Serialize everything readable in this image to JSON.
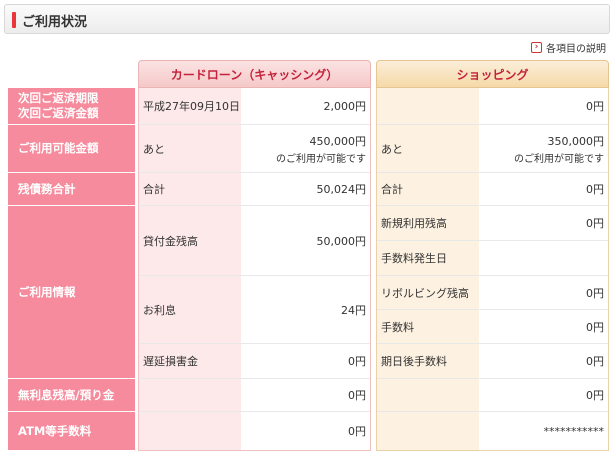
{
  "header": {
    "title": "ご利用状況"
  },
  "help": {
    "label": "各項目の説明"
  },
  "columns": {
    "card": "カードローン（キャッシング）",
    "shopping": "ショッピング"
  },
  "rows": {
    "next_payment": "次回ご返済期限\n次回ご返済金額",
    "available": "ご利用可能金額",
    "balance_total": "残債務合計",
    "usage_info": "ご利用情報",
    "interest_free": "無利息残高/預り金",
    "atm_fee": "ATM等手数料"
  },
  "card": {
    "next_date": "平成27年09月10日",
    "next_amount": "2,000円",
    "available_label": "あと",
    "available_amount": "450,000円",
    "available_note": "のご利用が可能です",
    "total_label": "合計",
    "total_amount": "50,024円",
    "loan_label": "貸付金残高",
    "loan_amount": "50,000円",
    "interest_label": "お利息",
    "interest_amount": "24円",
    "late_label": "遅延損害金",
    "late_amount": "0円",
    "interest_free_amount": "0円",
    "atm_amount": "0円"
  },
  "shopping": {
    "next_amount": "0円",
    "available_label": "あと",
    "available_amount": "350,000円",
    "available_note": "のご利用が可能です",
    "total_label": "合計",
    "total_amount": "0円",
    "new_label": "新規利用残高",
    "new_amount": "0円",
    "fee_date_label": "手数料発生日",
    "revo_label": "リボルビング残高",
    "revo_amount": "0円",
    "fee_label": "手数料",
    "fee_amount": "0円",
    "after_due_label": "期日後手数料",
    "after_due_amount": "0円",
    "interest_free_amount": "0円",
    "atm_amount": "***********"
  }
}
